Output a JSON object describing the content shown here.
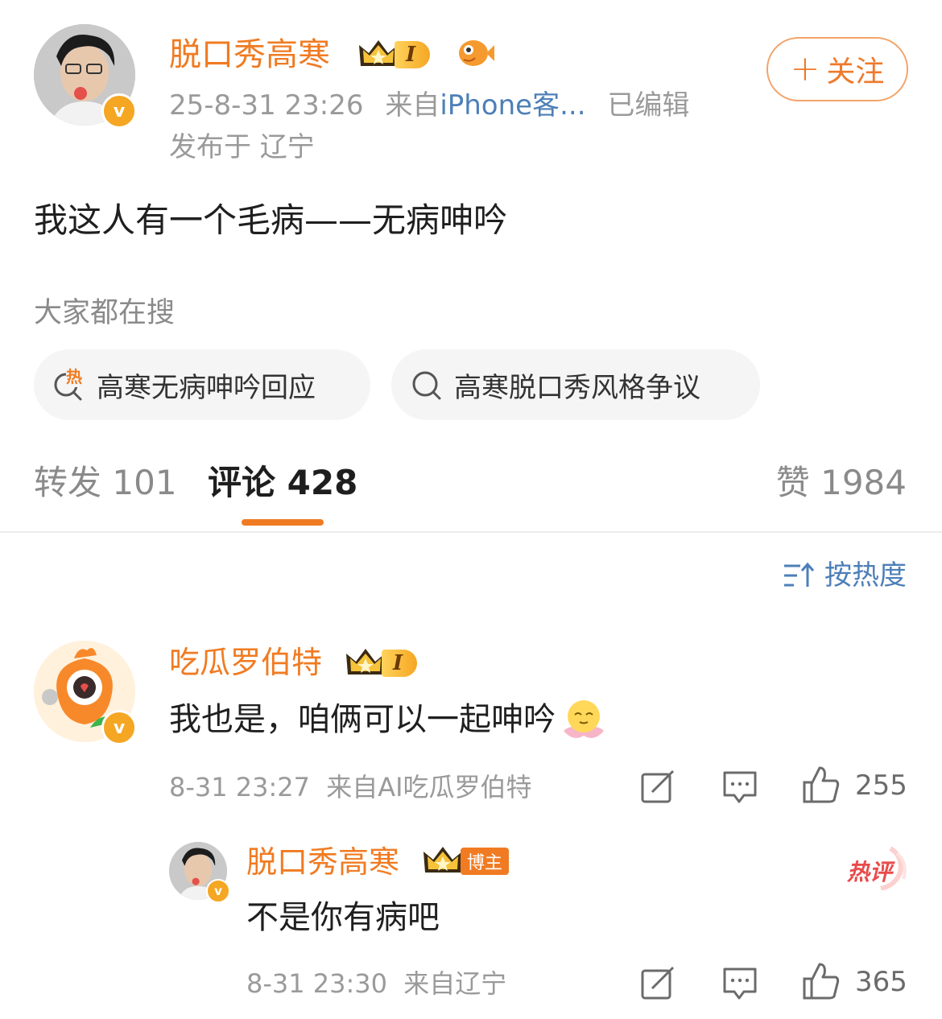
{
  "post": {
    "author": "脱口秀高寒",
    "time": "25-8-31 23:26",
    "source_prefix": "来自",
    "source_device": "iPhone客...",
    "edited": "已编辑",
    "location": "发布于 辽宁",
    "follow_label": "关注",
    "level": "I",
    "content": "我这人有一个毛病——无病呻吟"
  },
  "search": {
    "heading": "大家都在搜",
    "hot_tag": "热",
    "suggestions": [
      "高寒无病呻吟回应",
      "高寒脱口秀风格争议"
    ]
  },
  "tabs": {
    "repost_label": "转发",
    "repost_count": "101",
    "comment_label": "评论",
    "comment_count": "428",
    "like_label": "赞",
    "like_count": "1984"
  },
  "sort": {
    "label": "按热度"
  },
  "comments": [
    {
      "author": "吃瓜罗伯特",
      "level": "I",
      "text": "我也是，咱俩可以一起呻吟",
      "time": "8-31 23:27",
      "source": "来自AI吃瓜罗伯特",
      "likes": "255"
    }
  ],
  "reply": {
    "author": "脱口秀高寒",
    "owner_badge": "博主",
    "text": "不是你有病吧",
    "time": "8-31 23:30",
    "source": "来自辽宁",
    "likes": "365",
    "hot_badge": "热评"
  },
  "colors": {
    "accent": "#f07b22",
    "link": "#4d7fb8",
    "meta": "#9a9a9a"
  }
}
